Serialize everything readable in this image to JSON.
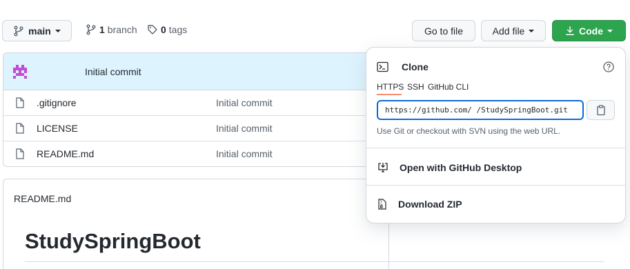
{
  "toolbar": {
    "branch_button_label": "main",
    "branch_count": "1",
    "branch_word": "branch",
    "tag_count": "0",
    "tag_word": "tags",
    "go_to_file_label": "Go to file",
    "add_file_label": "Add file",
    "code_label": "Code"
  },
  "commit_bar": {
    "message": "Initial commit"
  },
  "files": [
    {
      "name": ".gitignore",
      "message": "Initial commit"
    },
    {
      "name": "LICENSE",
      "message": "Initial commit"
    },
    {
      "name": "README.md",
      "message": "Initial commit"
    }
  ],
  "readme": {
    "header": "README.md",
    "title": "StudySpringBoot"
  },
  "clone_popover": {
    "title": "Clone",
    "tabs": [
      "HTTPS",
      "SSH",
      "GitHub CLI"
    ],
    "active_tab": "HTTPS",
    "url_value": "https://github.com/          /StudySpringBoot.git",
    "hint": "Use Git or checkout with SVN using the web URL.",
    "open_desktop_label": "Open with GitHub Desktop",
    "download_zip_label": "Download ZIP"
  },
  "colors": {
    "primary_green": "#2da44e",
    "active_tab_underline": "#fd8c73",
    "input_focus": "#0969da",
    "commit_bar_bg": "#ddf4ff"
  },
  "icons": {
    "branch": "git-branch-icon",
    "tag": "tag-icon",
    "download": "download-icon",
    "file": "file-icon",
    "terminal": "terminal-icon",
    "help": "question-circle-icon",
    "copy": "clipboard-icon",
    "desktop": "desktop-download-icon",
    "zip": "file-zip-icon",
    "avatar": "identicon-avatar"
  }
}
